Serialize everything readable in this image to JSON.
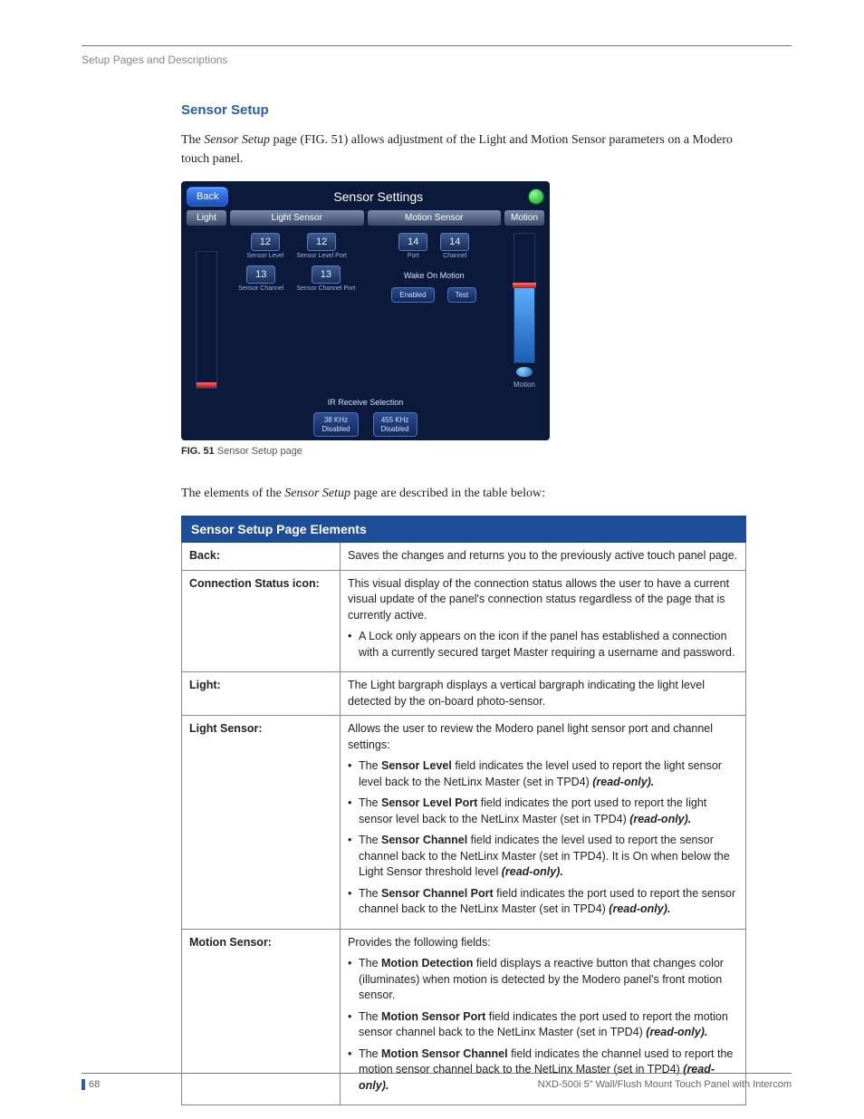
{
  "breadcrumb": "Setup Pages and Descriptions",
  "section_title": "Sensor Setup",
  "intro_prefix": "The ",
  "intro_em": "Sensor Setup",
  "intro_suffix": " page (FIG. 51) allows adjustment of the Light and Motion Sensor parameters on a Modero touch panel.",
  "figure": {
    "back": "Back",
    "title": "Sensor Settings",
    "side_left": "Light",
    "side_right": "Motion",
    "panel_left": "Light Sensor",
    "panel_right": "Motion Sensor",
    "light": {
      "sensor_level": "12",
      "sensor_level_label": "Sensor Level",
      "sensor_level_port": "12",
      "sensor_level_port_label": "Sensor Level Port",
      "sensor_channel": "13",
      "sensor_channel_label": "Sensor Channel",
      "sensor_channel_port": "13",
      "sensor_channel_port_label": "Sensor Channel Port"
    },
    "motion": {
      "port": "14",
      "port_label": "Port",
      "channel": "14",
      "channel_label": "Channel",
      "wake_label": "Wake On Motion",
      "enabled": "Enabled",
      "test": "Test"
    },
    "ir": {
      "title": "IR Receive Selection",
      "opt1_line1": "38 KHz",
      "opt1_line2": "Disabled",
      "opt2_line1": "455 KHz",
      "opt2_line2": "Disabled"
    },
    "motion_caption": "Motion"
  },
  "fig_caption_bold": "FIG. 51",
  "fig_caption_rest": "  Sensor Setup page",
  "table_intro_prefix": "The elements of the ",
  "table_intro_em": "Sensor Setup",
  "table_intro_suffix": " page are described in the table below:",
  "table": {
    "title": "Sensor Setup Page Elements",
    "rows": {
      "back": {
        "key": "Back:",
        "val": "Saves the changes and returns you to the previously active touch panel page."
      },
      "conn": {
        "key": "Connection Status icon:",
        "val": "This visual display of the connection status allows the user to have a current visual update of the panel's connection status regardless of the page that is currently active.",
        "b1": "A Lock only appears on the icon if the panel has established a connection with a currently secured target Master requiring a username and password."
      },
      "light": {
        "key": "Light:",
        "val": "The Light bargraph displays a vertical bargraph indicating the light level detected by the on-board photo-sensor."
      },
      "lightsensor": {
        "key": "Light Sensor:",
        "val": "Allows the user to review the Modero panel light sensor port and channel settings:",
        "b1_pre": "The ",
        "b1_bold": "Sensor Level",
        "b1_post": " field indicates the level used to report the light sensor level back to the NetLinx Master (set in TPD4) ",
        "b2_pre": "The ",
        "b2_bold": "Sensor Level Port",
        "b2_post": " field indicates the port used to report the light sensor level back to the NetLinx Master (set in TPD4) ",
        "b3_pre": "The ",
        "b3_bold": "Sensor Channel",
        "b3_post": " field indicates the level used to report the sensor channel back to the NetLinx Master (set in TPD4). It is On when below the Light Sensor threshold level ",
        "b4_pre": "The ",
        "b4_bold": "Sensor Channel Port",
        "b4_post": " field indicates the port used to report the sensor channel back to the NetLinx Master (set in TPD4) "
      },
      "motionsensor": {
        "key": "Motion Sensor:",
        "val": "Provides the following fields:",
        "b1_pre": "The ",
        "b1_bold": "Motion Detection",
        "b1_post": " field displays a reactive button that changes color (illuminates) when motion is detected by the Modero panel's front motion sensor.",
        "b2_pre": "The ",
        "b2_bold": "Motion Sensor Port",
        "b2_post": " field indicates the port used to report the motion sensor channel back to the NetLinx Master (set in TPD4) ",
        "b3_pre": "The ",
        "b3_bold": "Motion Sensor Channel",
        "b3_post": " field indicates the channel used to report the motion sensor channel back to the NetLinx Master (set in TPD4) "
      }
    },
    "readonly": "(read-only)."
  },
  "footer": {
    "page": "68",
    "doc": "NXD-500i 5\" Wall/Flush Mount Touch Panel with Intercom"
  }
}
